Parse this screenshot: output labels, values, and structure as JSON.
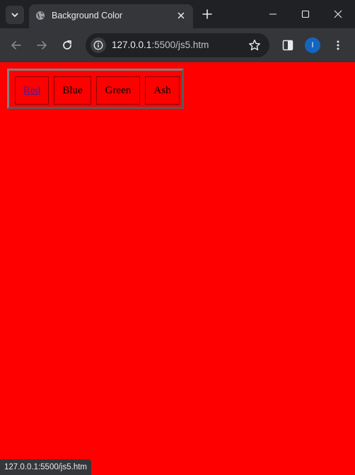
{
  "browser": {
    "tab": {
      "title": "Background Color",
      "favicon": "globe-icon"
    },
    "address": {
      "host": "127.0.0.1",
      "rest": ":5500/js5.htm"
    },
    "profile_initial": "I",
    "status_url": "127.0.0.1:5500/js5.htm"
  },
  "page": {
    "background_color": "#ff0000",
    "buttons": [
      {
        "label": "Red",
        "is_link": true
      },
      {
        "label": "Blue",
        "is_link": false
      },
      {
        "label": "Green",
        "is_link": false
      },
      {
        "label": "Ash",
        "is_link": false
      }
    ]
  },
  "colors": {
    "frame": "#202124",
    "toolbar": "#35363a",
    "page_red": "#ff0000",
    "link_visited": "#551a8b",
    "avatar": "#1565c0"
  }
}
